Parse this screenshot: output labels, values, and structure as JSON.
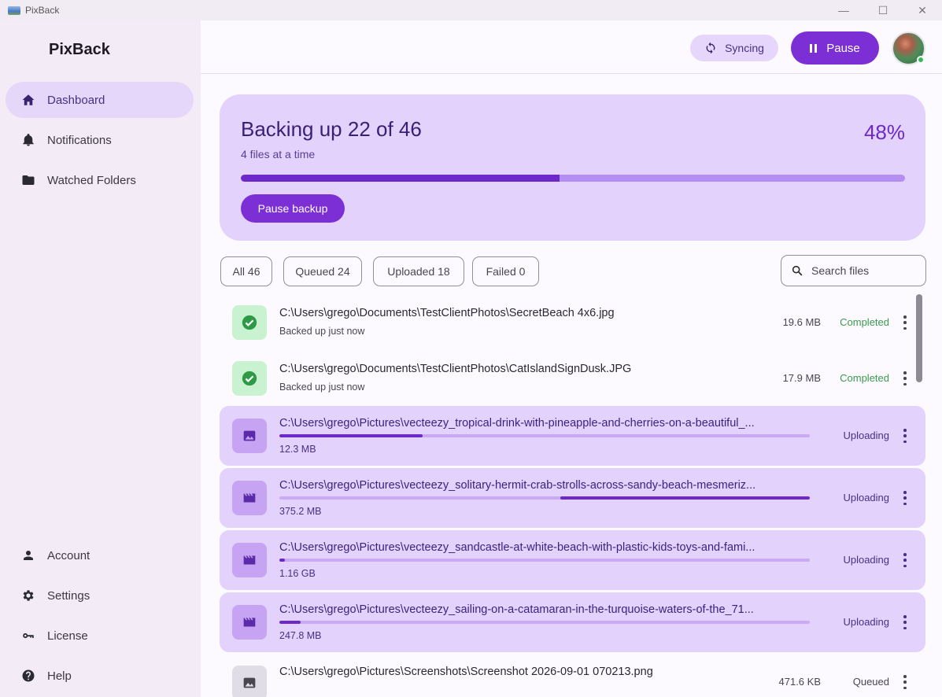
{
  "window": {
    "title": "PixBack",
    "minimize": "—",
    "maximize": "☐",
    "close": "✕"
  },
  "sidebar": {
    "brand": "PixBack",
    "items": [
      {
        "label": "Dashboard",
        "icon": "home-icon",
        "active": true
      },
      {
        "label": "Notifications",
        "icon": "bell-icon",
        "active": false
      },
      {
        "label": "Watched Folders",
        "icon": "folder-icon",
        "active": false
      }
    ],
    "bottom_items": [
      {
        "label": "Account",
        "icon": "person-icon"
      },
      {
        "label": "Settings",
        "icon": "gear-icon"
      },
      {
        "label": "License",
        "icon": "key-icon"
      },
      {
        "label": "Help",
        "icon": "help-icon"
      }
    ]
  },
  "topbar": {
    "sync_label": "Syncing",
    "pause_label": "Pause",
    "avatar_status_color": "#2fbf58"
  },
  "backup": {
    "title": "Backing up 22 of 46",
    "subtitle": "4 files at a time",
    "percent_label": "48%",
    "progress": 0.48,
    "button_label": "Pause backup"
  },
  "filters": [
    {
      "label": "All 46"
    },
    {
      "label": "Queued 24"
    },
    {
      "label": "Uploaded 18"
    },
    {
      "label": "Failed 0"
    }
  ],
  "search": {
    "placeholder": "Search files"
  },
  "files": [
    {
      "path": "C:\\Users\\grego\\Documents\\TestClientPhotos\\SecretBeach 4x6.jpg",
      "sub": "Backed up just now",
      "size": "19.6 MB",
      "status": "Completed",
      "state": "completed",
      "icon": "check-circle-icon"
    },
    {
      "path": "C:\\Users\\grego\\Documents\\TestClientPhotos\\CatIslandSignDusk.JPG",
      "sub": "Backed up just now",
      "size": "17.9 MB",
      "status": "Completed",
      "state": "completed",
      "icon": "check-circle-icon"
    },
    {
      "path": "C:\\Users\\grego\\Pictures\\vecteezy_tropical-drink-with-pineapple-and-cherries-on-a-beautiful_...",
      "sub": "12.3 MB",
      "size": "",
      "status": "Uploading",
      "state": "uploading",
      "icon": "image-icon",
      "progress": 0.27,
      "progress_start": 0
    },
    {
      "path": "C:\\Users\\grego\\Pictures\\vecteezy_solitary-hermit-crab-strolls-across-sandy-beach-mesmeriz...",
      "sub": "375.2 MB",
      "size": "",
      "status": "Uploading",
      "state": "uploading",
      "icon": "video-icon",
      "progress": 0.47,
      "progress_start": 0.53
    },
    {
      "path": "C:\\Users\\grego\\Pictures\\vecteezy_sandcastle-at-white-beach-with-plastic-kids-toys-and-fami...",
      "sub": "1.16 GB",
      "size": "",
      "status": "Uploading",
      "state": "uploading",
      "icon": "video-icon",
      "progress": 0.01,
      "progress_start": 0
    },
    {
      "path": "C:\\Users\\grego\\Pictures\\vecteezy_sailing-on-a-catamaran-in-the-turquoise-waters-of-the_71...",
      "sub": "247.8 MB",
      "size": "",
      "status": "Uploading",
      "state": "uploading",
      "icon": "video-icon",
      "progress": 0.04,
      "progress_start": 0
    },
    {
      "path": "C:\\Users\\grego\\Pictures\\Screenshots\\Screenshot 2026-09-01 070213.png",
      "sub": "",
      "size": "471.6 KB",
      "status": "Queued",
      "state": "queued",
      "icon": "image-icon"
    }
  ],
  "colors": {
    "accent": "#7b2fd4",
    "completed": "#3a9a4e",
    "card": "#e3d2fb"
  }
}
